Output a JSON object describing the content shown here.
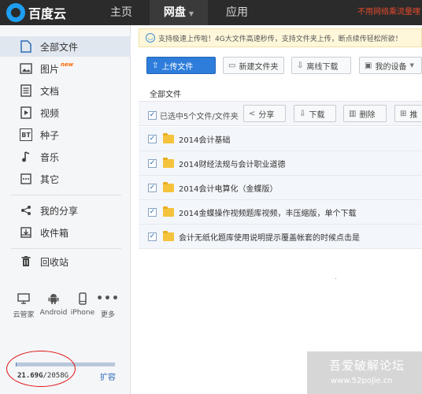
{
  "header": {
    "logo_text": "百度云",
    "nav": [
      "主页",
      "网盘",
      "应用"
    ],
    "tip": "不用网络乘流量哩"
  },
  "sidebar": {
    "items": [
      {
        "label": "全部文件",
        "icon": "file-icon"
      },
      {
        "label": "图片",
        "icon": "image-icon",
        "badge": "new"
      },
      {
        "label": "文档",
        "icon": "document-icon"
      },
      {
        "label": "视频",
        "icon": "video-icon"
      },
      {
        "label": "种子",
        "icon": "bt-icon",
        "icon_text": "BT"
      },
      {
        "label": "音乐",
        "icon": "music-icon"
      },
      {
        "label": "其它",
        "icon": "more-icon"
      },
      {
        "label": "我的分享",
        "icon": "share-icon"
      },
      {
        "label": "收件箱",
        "icon": "inbox-icon"
      },
      {
        "label": "回收站",
        "icon": "trash-icon"
      }
    ],
    "devices": [
      {
        "label": "云管家",
        "icon": "monitor-icon"
      },
      {
        "label": "Android",
        "icon": "android-icon"
      },
      {
        "label": "iPhone",
        "icon": "phone-icon"
      },
      {
        "label": "更多",
        "icon": "ellipsis-icon"
      }
    ],
    "quota": {
      "used": "21.69G",
      "total": "/2058G",
      "used_fraction": 0.0105,
      "expand": "扩容"
    }
  },
  "notice": "支持极速上传啦！4G大文件高速秒传，支持文件夹上传，断点续传轻松所欲！",
  "toolbar": {
    "upload": "上传文件",
    "new_folder": "新建文件夹",
    "offline": "离线下载",
    "devices": "我的设备"
  },
  "breadcrumb": "全部文件",
  "selection": {
    "label": "已选中5个文件/文件夹",
    "share": "分享",
    "download": "下载",
    "delete": "删除",
    "more": "推"
  },
  "files": [
    "2014会计基础",
    "2014财经法规与会计职业道德",
    "2014会计电算化（金蝶版）",
    "2014金蝶操作视频题库视频，丰压缩版，单个下载",
    "会计无纸化题库使用说明提示覆盖帐套的时候点击是"
  ],
  "watermark": {
    "title": "吾爱破解论坛",
    "url": "www.52pojie.cn"
  },
  "colors": {
    "accent": "#2e7ddb",
    "nav_bg": "#2b2b2b",
    "annotation": "#e01010"
  }
}
